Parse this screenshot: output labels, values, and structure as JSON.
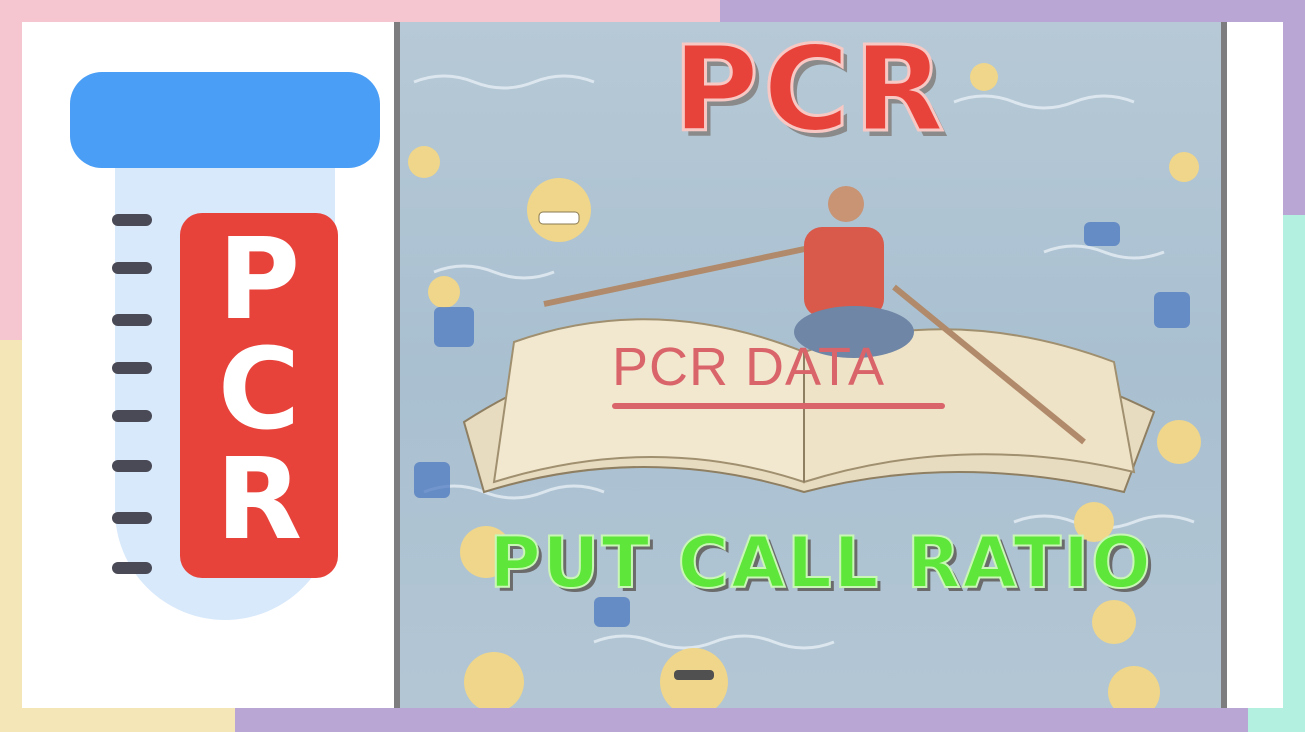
{
  "headline": "PCR",
  "photo": {
    "sign_text": "PCR DATA",
    "description_icons": [
      "emoji-icon",
      "thumbs-up-icon",
      "heart-eyes-icon",
      "book-icon",
      "rower-icon"
    ]
  },
  "subheadline": "PUT CALL RATIO",
  "logo": {
    "letters": [
      "P",
      "C",
      "R"
    ],
    "icon": "test-tube-icon"
  },
  "colors": {
    "headline_red": "#e8433b",
    "subheadline_green": "#5ee63a",
    "tube_cap_blue": "#4a9ef5",
    "tube_body": "#d8e9fb",
    "label_red": "#e8433b",
    "frame_pink": "#f5c6cf",
    "frame_purple": "#b9a6d4",
    "frame_yellow": "#f5e6b8",
    "frame_teal": "#b3f0e0"
  }
}
